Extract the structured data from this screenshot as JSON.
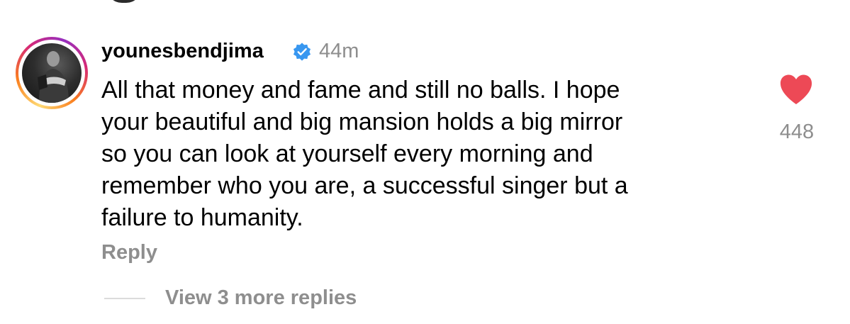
{
  "comment": {
    "username": "younesbendjima",
    "verified": true,
    "timestamp": "44m",
    "lines": [
      "All that money and fame and still no balls. I hope",
      "your beautiful and big mansion holds a big mirror",
      "so you can look at yourself every morning and",
      "remember who you are, a successful singer but a",
      "failure to humanity."
    ],
    "reply_label": "Reply",
    "view_replies_label": "View 3 more replies",
    "likes": "448",
    "liked": true
  },
  "icons": {
    "verified": "verified-badge-icon",
    "like": "heart-filled-icon"
  },
  "colors": {
    "like_heart": "#ed4956",
    "verified_blue": "#3897f0",
    "muted_text": "#8e8e8e"
  }
}
